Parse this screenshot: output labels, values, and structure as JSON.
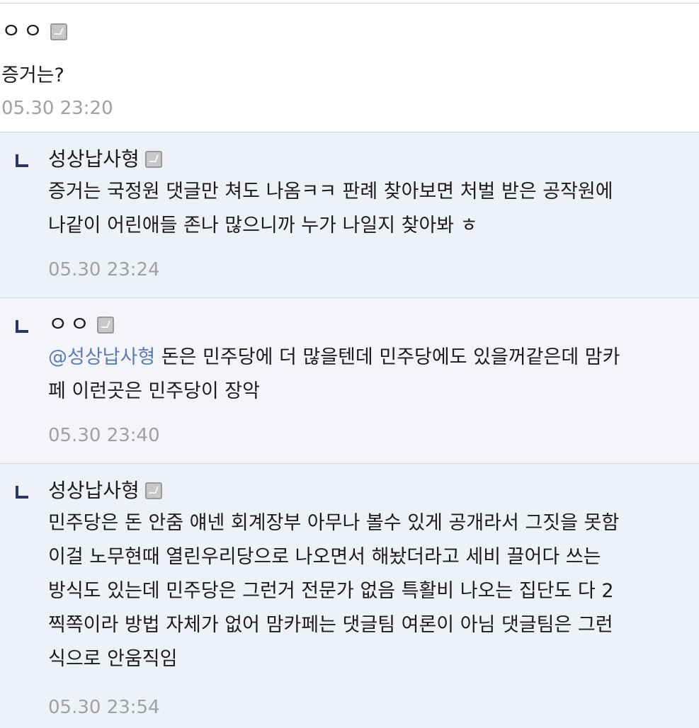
{
  "comments": [
    {
      "nickname": "ㅇㅇ",
      "text": "증거는?",
      "time": "05.30 23:20"
    }
  ],
  "replies": [
    {
      "nickname": "성상납사형",
      "lines": [
        "증거는 국정원 댓글만 쳐도 나옴ㅋㅋ 판례 찾아보면 처벌 받은 공작원에",
        "나같이 어린애들 존나 많으니까 누가 나일지 찾아봐 ㅎ"
      ],
      "time": "05.30 23:24"
    },
    {
      "nickname": "ㅇㅇ",
      "mention": "@성상납사형",
      "lines": [
        " 돈은 민주당에 더 많을텐데 민주당에도 있을꺼같은데 맘카",
        "페 이런곳은 민주당이 장악"
      ],
      "time": "05.30 23:40"
    },
    {
      "nickname": "성상납사형",
      "lines": [
        "민주당은 돈 안줌 얘넨 회계장부 아무나 볼수 있게 공개라서 그짓을 못함",
        "이걸 노무현때 열린우리당으로 나오면서 해놨더라고 세비 끌어다 쓰는",
        "방식도 있는데 민주당은 그런거 전문가 없음 특활비 나오는 집단도 다 2",
        "찍쪽이라 방법 자체가 없어 맘카페는 댓글팀 여론이 아님 댓글팀은 그런",
        "식으로 안움직임"
      ],
      "time": "05.30 23:54"
    }
  ],
  "icons": {
    "member_badge": "member-badge-icon",
    "reply_arrow": "reply-arrow-icon"
  },
  "colors": {
    "mention": "#5b7cb8",
    "reply_background": "#eff1f8",
    "timestamp": "#a0a0a6",
    "reply_icon": "#2a3566"
  }
}
